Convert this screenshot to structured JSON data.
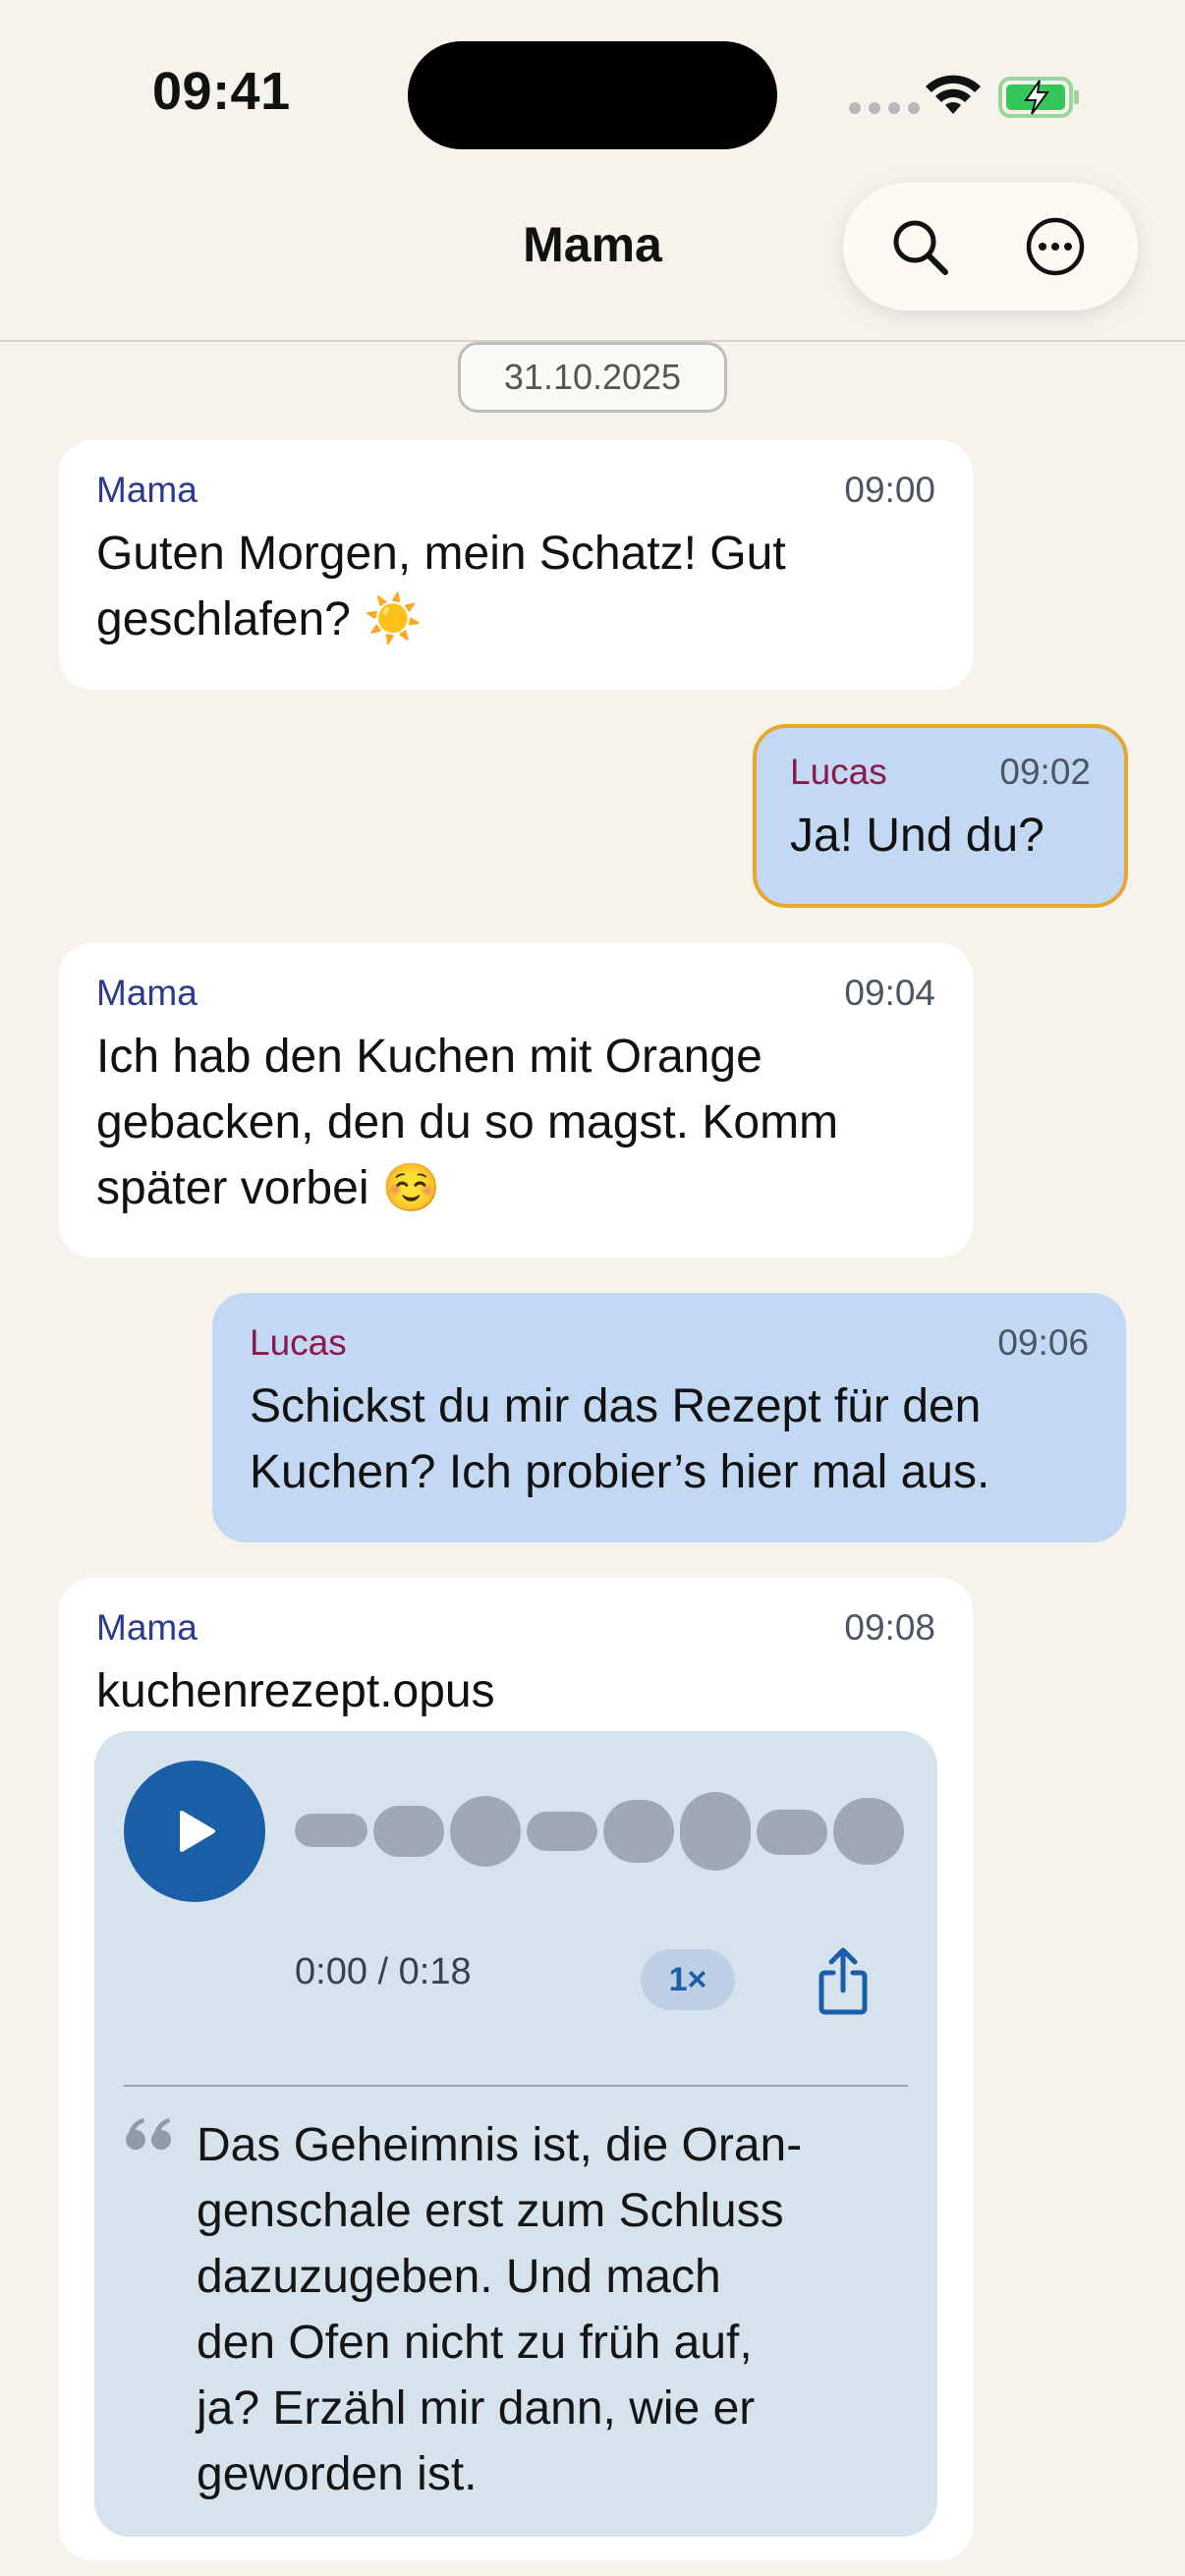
{
  "status_bar": {
    "time": "09:41"
  },
  "header": {
    "title": "Mama"
  },
  "date_label": "31.10.2025",
  "messages": [
    {
      "sender": "Mama",
      "time": "09:00",
      "text": "Guten Morgen, mein Schatz! Gut geschlafen? ☀️"
    },
    {
      "sender": "Lucas",
      "time": "09:02",
      "text": "Ja! Und du?"
    },
    {
      "sender": "Mama",
      "time": "09:04",
      "text": "Ich hab den Kuchen mit Orange gebacken, den du so magst. Komm später vorbei ☺️"
    },
    {
      "sender": "Lucas",
      "time": "09:06",
      "text": "Schickst du mir das Rezept für den Kuchen? Ich probier’s hier mal aus."
    },
    {
      "sender": "Mama",
      "time": "09:08",
      "text": "kuchenrezept.opus",
      "audio": {
        "position": "0:00 / 0:18",
        "speed": "1×",
        "transcript_lines": [
          "Das Geheimnis ist, die Oran-",
          "genschale erst zum Schluss",
          "dazuzugeben. Und mach",
          "den Ofen nicht zu früh auf,",
          "ja? Erzähl mir dann, wie er",
          "geworden ist."
        ]
      }
    }
  ],
  "colors": {
    "background": "#f5f3ec",
    "incoming_bubble": "#ffffff",
    "outgoing_bubble": "#c3d8f2",
    "highlight_border": "#e6a730",
    "mama_name": "#2a3a8c",
    "lucas_name": "#8a1a4c",
    "play_button": "#1a5ea8"
  },
  "icons": {
    "search": "search-icon",
    "more": "more-options-icon",
    "play": "play-icon",
    "share": "share-icon",
    "quote": "quote-icon"
  }
}
